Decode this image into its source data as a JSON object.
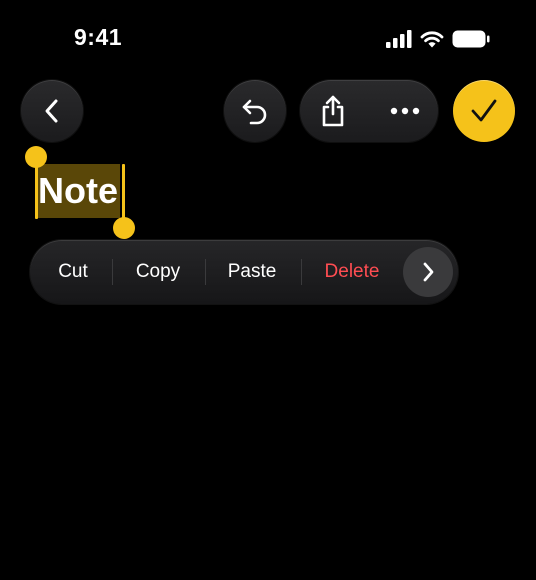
{
  "status_bar": {
    "time": "9:41",
    "icons": [
      "cellular-signal-icon",
      "wifi-icon",
      "battery-icon"
    ]
  },
  "toolbar": {
    "back_icon": "chevron-left-icon",
    "undo_icon": "undo-icon",
    "share_icon": "share-icon",
    "more_icon": "ellipsis-icon",
    "done_icon": "checkmark-icon",
    "done_color": "#f5c21a"
  },
  "note": {
    "title": "Note",
    "selection_color": "#5a4708",
    "handle_color": "#f5c21a"
  },
  "edit_menu": {
    "items": [
      {
        "label": "Cut",
        "destructive": false
      },
      {
        "label": "Copy",
        "destructive": false
      },
      {
        "label": "Paste",
        "destructive": false
      },
      {
        "label": "Delete",
        "destructive": true
      }
    ],
    "more_icon": "chevron-right-icon",
    "destructive_color": "#ff4d52"
  }
}
